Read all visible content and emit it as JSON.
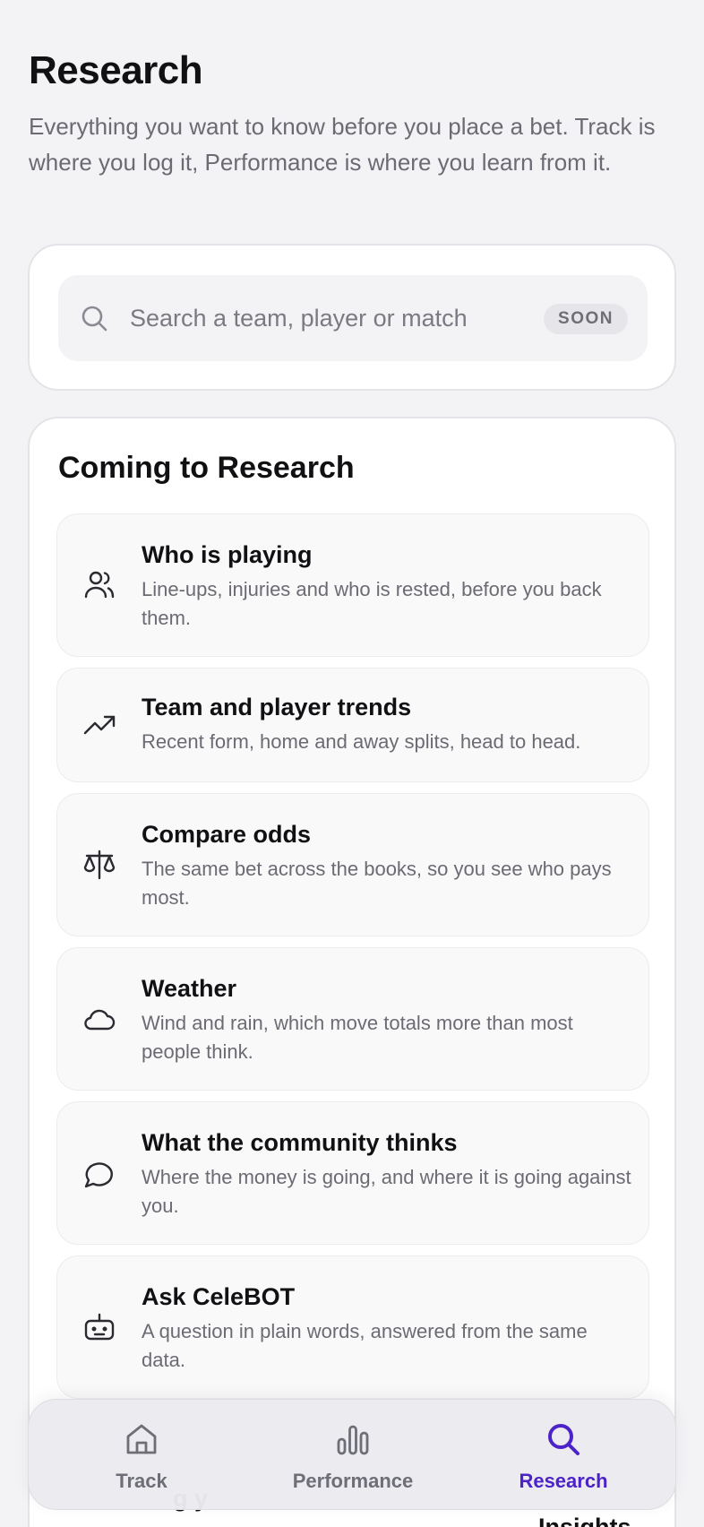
{
  "header": {
    "title": "Research",
    "subtitle": "Everything you want to know before you place a bet. Track is where you log it, Performance is where you learn from it."
  },
  "search": {
    "placeholder": "Search a team, player or match",
    "value": "",
    "badge": "SOON",
    "icon": "search-icon"
  },
  "features_section": {
    "title": "Coming to Research",
    "items": [
      {
        "icon": "users-icon",
        "title": "Who is playing",
        "description": "Line-ups, injuries and who is rested, before you back them."
      },
      {
        "icon": "trending-up-icon",
        "title": "Team and player trends",
        "description": "Recent form, home and away splits, head to head."
      },
      {
        "icon": "scale-icon",
        "title": "Compare odds",
        "description": "The same bet across the books, so you see who pays most."
      },
      {
        "icon": "cloud-icon",
        "title": "Weather",
        "description": "Wind and rain, which move totals more than most people think."
      },
      {
        "icon": "chat-bubble-icon",
        "title": "What the community thinks",
        "description": "Where the money is going, and where it is going against you."
      },
      {
        "icon": "robot-icon",
        "title": "Ask CeleBOT",
        "description": "A question in plain words, answered from the same data."
      }
    ]
  },
  "peek": {
    "left": "g  y",
    "right": "Insights"
  },
  "bottom_nav": {
    "active_color": "#4b23c8",
    "inactive_color": "#6e6e76",
    "items": [
      {
        "icon": "home-icon",
        "label": "Track",
        "active": false
      },
      {
        "icon": "bar-chart-icon",
        "label": "Performance",
        "active": false
      },
      {
        "icon": "search-icon",
        "label": "Research",
        "active": true
      }
    ]
  }
}
